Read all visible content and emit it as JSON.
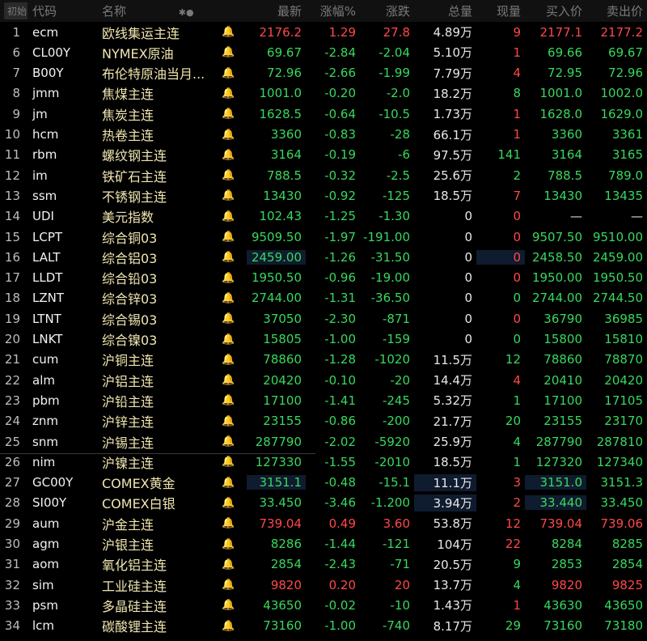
{
  "header": {
    "badge": "初始",
    "col_code": "代码",
    "col_name": "名称",
    "col_icons": "✱●",
    "col_last": "最新",
    "col_pct": "涨幅%",
    "col_chg": "涨跌",
    "col_vol": "总量",
    "col_cur": "现量",
    "col_bid": "买入价",
    "col_ask": "卖出价"
  },
  "colors": {
    "up": "#ff4848",
    "down": "#38d85e",
    "name": "#f0e6b0",
    "bell_alert": "#ff5a2a"
  },
  "rows": [
    {
      "idx": "1",
      "code": "ecm",
      "name": "欧线集运主连",
      "bell": "grey",
      "last": "2176.2",
      "pct": "1.29",
      "chg": "27.8",
      "vol": "4.89万",
      "cur": "9",
      "bid": "2177.1",
      "ask": "2177.2",
      "last_c": "up",
      "pct_c": "up",
      "chg_c": "up",
      "cur_c": "up",
      "bid_c": "up",
      "ask_c": "up"
    },
    {
      "idx": "6",
      "code": "CL00Y",
      "name": "NYMEX原油",
      "bell": "grey",
      "last": "69.67",
      "pct": "-2.84",
      "chg": "-2.04",
      "vol": "5.10万",
      "cur": "1",
      "bid": "69.66",
      "ask": "69.67",
      "last_c": "dn",
      "pct_c": "dn",
      "chg_c": "dn",
      "cur_c": "up",
      "bid_c": "dn",
      "ask_c": "dn"
    },
    {
      "idx": "7",
      "code": "B00Y",
      "name": "布伦特原油当月...",
      "bell": "grey",
      "last": "72.96",
      "pct": "-2.66",
      "chg": "-1.99",
      "vol": "7.79万",
      "cur": "4",
      "bid": "72.95",
      "ask": "72.96",
      "last_c": "dn",
      "pct_c": "dn",
      "chg_c": "dn",
      "cur_c": "up",
      "bid_c": "dn",
      "ask_c": "dn"
    },
    {
      "idx": "8",
      "code": "jmm",
      "name": "焦煤主连",
      "bell": "grey",
      "last": "1001.0",
      "pct": "-0.20",
      "chg": "-2.0",
      "vol": "18.2万",
      "cur": "8",
      "bid": "1001.0",
      "ask": "1002.0",
      "last_c": "dn",
      "pct_c": "dn",
      "chg_c": "dn",
      "cur_c": "dn",
      "bid_c": "dn",
      "ask_c": "dn"
    },
    {
      "idx": "9",
      "code": "jm",
      "name": "焦炭主连",
      "bell": "grey",
      "last": "1628.5",
      "pct": "-0.64",
      "chg": "-10.5",
      "vol": "1.73万",
      "cur": "1",
      "bid": "1628.0",
      "ask": "1629.0",
      "last_c": "dn",
      "pct_c": "dn",
      "chg_c": "dn",
      "cur_c": "up",
      "bid_c": "dn",
      "ask_c": "dn"
    },
    {
      "idx": "10",
      "code": "hcm",
      "name": "热卷主连",
      "bell": "grey",
      "last": "3360",
      "pct": "-0.83",
      "chg": "-28",
      "vol": "66.1万",
      "cur": "1",
      "bid": "3360",
      "ask": "3361",
      "last_c": "dn",
      "pct_c": "dn",
      "chg_c": "dn",
      "cur_c": "up",
      "bid_c": "dn",
      "ask_c": "dn"
    },
    {
      "idx": "11",
      "code": "rbm",
      "name": "螺纹钢主连",
      "bell": "grey",
      "last": "3164",
      "pct": "-0.19",
      "chg": "-6",
      "vol": "97.5万",
      "cur": "141",
      "bid": "3164",
      "ask": "3165",
      "last_c": "dn",
      "pct_c": "dn",
      "chg_c": "dn",
      "cur_c": "dn",
      "bid_c": "dn",
      "ask_c": "dn"
    },
    {
      "idx": "12",
      "code": "im",
      "name": "铁矿石主连",
      "bell": "grey",
      "last": "788.5",
      "pct": "-0.32",
      "chg": "-2.5",
      "vol": "25.6万",
      "cur": "2",
      "bid": "788.5",
      "ask": "789.0",
      "last_c": "dn",
      "pct_c": "dn",
      "chg_c": "dn",
      "cur_c": "dn",
      "bid_c": "dn",
      "ask_c": "dn"
    },
    {
      "idx": "13",
      "code": "ssm",
      "name": "不锈钢主连",
      "bell": "grey",
      "last": "13430",
      "pct": "-0.92",
      "chg": "-125",
      "vol": "18.5万",
      "cur": "7",
      "bid": "13430",
      "ask": "13435",
      "last_c": "dn",
      "pct_c": "dn",
      "chg_c": "dn",
      "cur_c": "up",
      "bid_c": "dn",
      "ask_c": "dn"
    },
    {
      "idx": "14",
      "code": "UDI",
      "name": "美元指数",
      "bell": "grey",
      "last": "102.43",
      "pct": "-1.25",
      "chg": "-1.30",
      "vol": "0",
      "cur": "0",
      "bid": "—",
      "ask": "—",
      "last_c": "dn",
      "pct_c": "dn",
      "chg_c": "dn",
      "cur_c": "up",
      "bid_c": "flat",
      "ask_c": "flat"
    },
    {
      "idx": "15",
      "code": "LCPT",
      "name": "综合铜03",
      "bell": "grey",
      "last": "9509.50",
      "pct": "-1.97",
      "chg": "-191.00",
      "vol": "0",
      "cur": "0",
      "bid": "9507.50",
      "ask": "9510.00",
      "last_c": "dn",
      "pct_c": "dn",
      "chg_c": "dn",
      "cur_c": "up",
      "bid_c": "dn",
      "ask_c": "dn"
    },
    {
      "idx": "16",
      "code": "LALT",
      "name": "综合铝03",
      "bell": "grey",
      "last": "2459.00",
      "pct": "-1.26",
      "chg": "-31.50",
      "vol": "0",
      "cur": "0",
      "bid": "2458.50",
      "ask": "2459.00",
      "last_c": "dn",
      "pct_c": "dn",
      "chg_c": "dn",
      "cur_c": "up",
      "bid_c": "dn",
      "ask_c": "dn",
      "hl_last": true,
      "hl_cur": true
    },
    {
      "idx": "17",
      "code": "LLDT",
      "name": "综合铅03",
      "bell": "grey",
      "last": "1950.50",
      "pct": "-0.96",
      "chg": "-19.00",
      "vol": "0",
      "cur": "0",
      "bid": "1950.00",
      "ask": "1950.50",
      "last_c": "dn",
      "pct_c": "dn",
      "chg_c": "dn",
      "cur_c": "up",
      "bid_c": "dn",
      "ask_c": "dn"
    },
    {
      "idx": "18",
      "code": "LZNT",
      "name": "综合锌03",
      "bell": "grey",
      "last": "2744.00",
      "pct": "-1.31",
      "chg": "-36.50",
      "vol": "0",
      "cur": "0",
      "bid": "2744.00",
      "ask": "2744.50",
      "last_c": "dn",
      "pct_c": "dn",
      "chg_c": "dn",
      "cur_c": "dn",
      "bid_c": "dn",
      "ask_c": "dn"
    },
    {
      "idx": "19",
      "code": "LTNT",
      "name": "综合锡03",
      "bell": "grey",
      "last": "37050",
      "pct": "-2.30",
      "chg": "-871",
      "vol": "0",
      "cur": "0",
      "bid": "36790",
      "ask": "36985",
      "last_c": "dn",
      "pct_c": "dn",
      "chg_c": "dn",
      "cur_c": "up",
      "bid_c": "dn",
      "ask_c": "dn"
    },
    {
      "idx": "20",
      "code": "LNKT",
      "name": "综合镍03",
      "bell": "grey",
      "last": "15805",
      "pct": "-1.00",
      "chg": "-159",
      "vol": "0",
      "cur": "0",
      "bid": "15800",
      "ask": "15810",
      "last_c": "dn",
      "pct_c": "dn",
      "chg_c": "dn",
      "cur_c": "dn",
      "bid_c": "dn",
      "ask_c": "dn"
    },
    {
      "idx": "21",
      "code": "cum",
      "name": "沪铜主连",
      "bell": "red",
      "last": "78860",
      "pct": "-1.28",
      "chg": "-1020",
      "vol": "11.5万",
      "cur": "12",
      "bid": "78860",
      "ask": "78870",
      "last_c": "dn",
      "pct_c": "dn",
      "chg_c": "dn",
      "cur_c": "dn",
      "bid_c": "dn",
      "ask_c": "dn"
    },
    {
      "idx": "22",
      "code": "alm",
      "name": "沪铝主连",
      "bell": "grey",
      "last": "20420",
      "pct": "-0.10",
      "chg": "-20",
      "vol": "14.4万",
      "cur": "4",
      "bid": "20410",
      "ask": "20420",
      "last_c": "dn",
      "pct_c": "dn",
      "chg_c": "dn",
      "cur_c": "up",
      "bid_c": "dn",
      "ask_c": "dn"
    },
    {
      "idx": "23",
      "code": "pbm",
      "name": "沪铅主连",
      "bell": "grey",
      "last": "17100",
      "pct": "-1.41",
      "chg": "-245",
      "vol": "5.32万",
      "cur": "1",
      "bid": "17100",
      "ask": "17105",
      "last_c": "dn",
      "pct_c": "dn",
      "chg_c": "dn",
      "cur_c": "dn",
      "bid_c": "dn",
      "ask_c": "dn"
    },
    {
      "idx": "24",
      "code": "znm",
      "name": "沪锌主连",
      "bell": "grey",
      "last": "23155",
      "pct": "-0.86",
      "chg": "-200",
      "vol": "21.7万",
      "cur": "20",
      "bid": "23155",
      "ask": "23170",
      "last_c": "dn",
      "pct_c": "dn",
      "chg_c": "dn",
      "cur_c": "dn",
      "bid_c": "dn",
      "ask_c": "dn"
    },
    {
      "idx": "25",
      "code": "snm",
      "name": "沪锡主连",
      "bell": "grey",
      "last": "287790",
      "pct": "-2.02",
      "chg": "-5920",
      "vol": "25.9万",
      "cur": "4",
      "bid": "287790",
      "ask": "287810",
      "last_c": "dn",
      "pct_c": "dn",
      "chg_c": "dn",
      "cur_c": "dn",
      "bid_c": "dn",
      "ask_c": "dn"
    },
    {
      "idx": "26",
      "code": "nim",
      "name": "沪镍主连",
      "bell": "grey",
      "last": "127330",
      "pct": "-1.55",
      "chg": "-2010",
      "vol": "18.5万",
      "cur": "1",
      "bid": "127320",
      "ask": "127340",
      "last_c": "dn",
      "pct_c": "dn",
      "chg_c": "dn",
      "cur_c": "dn",
      "bid_c": "dn",
      "ask_c": "dn"
    },
    {
      "idx": "27",
      "code": "GC00Y",
      "name": "COMEX黄金",
      "bell": "grey",
      "last": "3151.1",
      "pct": "-0.48",
      "chg": "-15.1",
      "vol": "11.1万",
      "cur": "3",
      "bid": "3151.0",
      "ask": "3151.3",
      "last_c": "dn",
      "pct_c": "dn",
      "chg_c": "dn",
      "cur_c": "up",
      "bid_c": "dn",
      "ask_c": "dn",
      "hl_last": true,
      "hl_vol": true,
      "hl_bid": true
    },
    {
      "idx": "28",
      "code": "SI00Y",
      "name": "COMEX白银",
      "bell": "red",
      "last": "33.450",
      "pct": "-3.46",
      "chg": "-1.200",
      "vol": "3.94万",
      "cur": "2",
      "bid": "33.440",
      "ask": "33.450",
      "last_c": "dn",
      "pct_c": "dn",
      "chg_c": "dn",
      "cur_c": "up",
      "bid_c": "dn",
      "ask_c": "dn",
      "hl_vol": true,
      "hl_bid": true
    },
    {
      "idx": "29",
      "code": "aum",
      "name": "沪金主连",
      "bell": "red",
      "last": "739.04",
      "pct": "0.49",
      "chg": "3.60",
      "vol": "53.8万",
      "cur": "12",
      "bid": "739.04",
      "ask": "739.06",
      "last_c": "up",
      "pct_c": "up",
      "chg_c": "up",
      "cur_c": "up",
      "bid_c": "up",
      "ask_c": "up"
    },
    {
      "idx": "30",
      "code": "agm",
      "name": "沪银主连",
      "bell": "grey",
      "last": "8286",
      "pct": "-1.44",
      "chg": "-121",
      "vol": "104万",
      "cur": "22",
      "bid": "8284",
      "ask": "8285",
      "last_c": "dn",
      "pct_c": "dn",
      "chg_c": "dn",
      "cur_c": "up",
      "bid_c": "dn",
      "ask_c": "dn"
    },
    {
      "idx": "31",
      "code": "aom",
      "name": "氧化铝主连",
      "bell": "grey",
      "last": "2854",
      "pct": "-2.43",
      "chg": "-71",
      "vol": "20.5万",
      "cur": "9",
      "bid": "2853",
      "ask": "2854",
      "last_c": "dn",
      "pct_c": "dn",
      "chg_c": "dn",
      "cur_c": "dn",
      "bid_c": "dn",
      "ask_c": "dn"
    },
    {
      "idx": "32",
      "code": "sim",
      "name": "工业硅主连",
      "bell": "grey",
      "last": "9820",
      "pct": "0.20",
      "chg": "20",
      "vol": "13.7万",
      "cur": "4",
      "bid": "9820",
      "ask": "9825",
      "last_c": "up",
      "pct_c": "up",
      "chg_c": "up",
      "cur_c": "dn",
      "bid_c": "up",
      "ask_c": "up"
    },
    {
      "idx": "33",
      "code": "psm",
      "name": "多晶硅主连",
      "bell": "grey",
      "last": "43650",
      "pct": "-0.02",
      "chg": "-10",
      "vol": "1.43万",
      "cur": "1",
      "bid": "43630",
      "ask": "43650",
      "last_c": "dn",
      "pct_c": "dn",
      "chg_c": "dn",
      "cur_c": "up",
      "bid_c": "dn",
      "ask_c": "dn"
    },
    {
      "idx": "34",
      "code": "lcm",
      "name": "碳酸锂主连",
      "bell": "grey",
      "last": "73160",
      "pct": "-1.00",
      "chg": "-740",
      "vol": "8.17万",
      "cur": "29",
      "bid": "73160",
      "ask": "73180",
      "last_c": "dn",
      "pct_c": "dn",
      "chg_c": "dn",
      "cur_c": "dn",
      "bid_c": "dn",
      "ask_c": "dn"
    }
  ]
}
